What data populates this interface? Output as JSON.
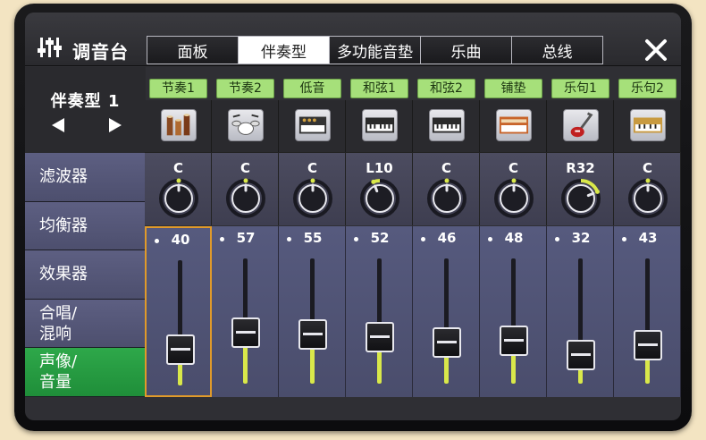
{
  "header": {
    "title": "调音台",
    "tabs": [
      {
        "label": "面板",
        "active": false
      },
      {
        "label": "伴奏型",
        "active": true
      },
      {
        "label": "多功能音垫",
        "active": false
      },
      {
        "label": "乐曲",
        "active": false
      },
      {
        "label": "总线",
        "active": false
      }
    ]
  },
  "preset": {
    "name": "伴奏型 1"
  },
  "side_menu": [
    {
      "label": "滤波器",
      "active": false
    },
    {
      "label": "均衡器",
      "active": false
    },
    {
      "label": "效果器",
      "active": false
    },
    {
      "label": "合唱/\n混响",
      "active": false
    },
    {
      "label": "声像/\n音量",
      "active": true
    }
  ],
  "channels": [
    {
      "label": "节奏1",
      "instrument": "percussion-icon",
      "pan": "C",
      "pan_value": 0,
      "volume": "40",
      "volume_level": 40,
      "selected": true
    },
    {
      "label": "节奏2",
      "instrument": "drum-kit-icon",
      "pan": "C",
      "pan_value": 0,
      "volume": "57",
      "volume_level": 57,
      "selected": false
    },
    {
      "label": "低音",
      "instrument": "synth-bass-icon",
      "pan": "C",
      "pan_value": 0,
      "volume": "55",
      "volume_level": 55,
      "selected": false
    },
    {
      "label": "和弦1",
      "instrument": "keyboard-icon",
      "pan": "L10",
      "pan_value": -10,
      "volume": "52",
      "volume_level": 52,
      "selected": false
    },
    {
      "label": "和弦2",
      "instrument": "keyboard-icon",
      "pan": "C",
      "pan_value": 0,
      "volume": "46",
      "volume_level": 46,
      "selected": false
    },
    {
      "label": "铺垫",
      "instrument": "organ-icon",
      "pan": "C",
      "pan_value": 0,
      "volume": "48",
      "volume_level": 48,
      "selected": false
    },
    {
      "label": "乐句1",
      "instrument": "electric-guitar-icon",
      "pan": "R32",
      "pan_value": 32,
      "volume": "32",
      "volume_level": 32,
      "selected": false
    },
    {
      "label": "乐句2",
      "instrument": "synth-keyboard-icon",
      "pan": "C",
      "pan_value": 0,
      "volume": "43",
      "volume_level": 43,
      "selected": false
    }
  ],
  "colors": {
    "accent_green": "#a6e07a",
    "active_green": "#2ea84a",
    "meter_yellow": "#d9e84a",
    "selected_border": "#e09a2a"
  }
}
